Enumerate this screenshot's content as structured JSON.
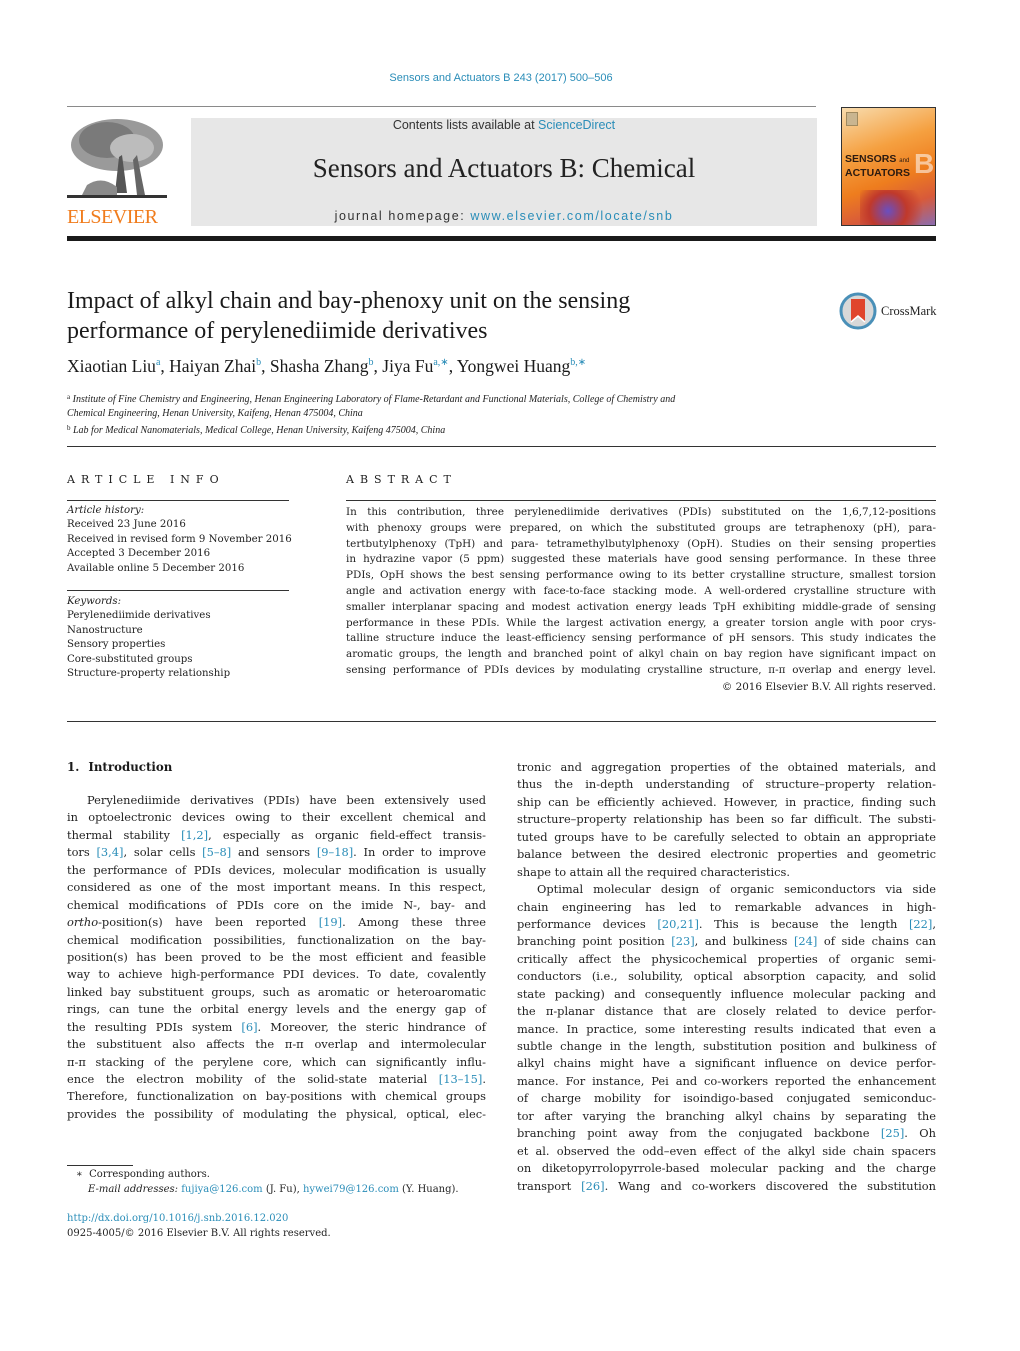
{
  "header": {
    "journal_ref": "Sensors and Actuators B 243 (2017) 500–506",
    "contents_prefix": "Contents lists available at ",
    "contents_link": "ScienceDirect",
    "journal_name": "Sensors and Actuators B: Chemical",
    "homepage_prefix": "journal homepage: ",
    "homepage_link": "www.elsevier.com/locate/snb",
    "publisher_logo_text": "ELSEVIER",
    "cover_title_line1": "SENSORS",
    "cover_title_and": "and",
    "cover_title_line2": "ACTUATORS",
    "cover_letter": "B"
  },
  "article": {
    "title_line1": "Impact of alkyl chain and bay-phenoxy unit on the sensing",
    "title_line2": "performance of perylenediimide derivatives",
    "crossmark_label": "CrossMark",
    "authors": [
      {
        "name": "Xiaotian Liu",
        "sup": "a",
        "sep": ", "
      },
      {
        "name": "Haiyan Zhai",
        "sup": "b",
        "sep": ", "
      },
      {
        "name": "Shasha Zhang",
        "sup": "b",
        "sep": ", "
      },
      {
        "name": "Jiya Fu",
        "sup": "a,∗",
        "sep": ", "
      },
      {
        "name": "Yongwei Huang",
        "sup": "b,∗",
        "sep": ""
      }
    ],
    "affiliations": [
      {
        "sup": "a",
        "line1": "Institute of Fine Chemistry and Engineering, Henan Engineering Laboratory of Flame-Retardant and Functional Materials, College of Chemistry and",
        "line2": "Chemical Engineering, Henan University, Kaifeng, Henan 475004, China"
      },
      {
        "sup": "b",
        "line1": "Lab for Medical Nanomaterials, Medical College, Henan University, Kaifeng 475004, China"
      }
    ]
  },
  "article_info": {
    "heading": "ARTICLE INFO",
    "history_label": "Article history:",
    "history": [
      "Received 23 June 2016",
      "Received in revised form 9 November 2016",
      "Accepted 3 December 2016",
      "Available online 5 December 2016"
    ],
    "keywords_label": "Keywords:",
    "keywords": [
      "Perylenediimide derivatives",
      "Nanostructure",
      "Sensory properties",
      "Core-substituted groups",
      "Structure-property relationship"
    ]
  },
  "abstract": {
    "heading": "ABSTRACT",
    "lines": [
      "In this contribution, three perylenediimide derivatives (PDIs) substituted on the 1,6,7,12-positions",
      "with phenoxy groups were prepared, on which the substituted groups are tetraphenoxy (pH), para-",
      "tertbutylphenoxy (TpH) and para- tetramethylbutylphenoxy (OpH). Studies on their sensing properties",
      "in hydrazine vapor (5 ppm) suggested these materials have good sensing performance. In these three",
      "PDIs, OpH shows the best sensing performance owing to its better crystalline structure, smallest torsion",
      "angle and activation energy with face-to-face stacking mode. A well-ordered crystalline structure with",
      "smaller interplanar spacing and modest activation energy leads TpH exhibiting middle-grade of sensing",
      "performance in these PDIs. While the largest activation energy, a greater torsion angle with poor crys-",
      "talline structure induce the least-efficiency sensing performance of pH sensors. This study indicates the",
      "aromatic groups, the length and branched point of alkyl chain on bay region have significant impact on",
      "sensing performance of PDIs devices by modulating crystalline structure, π-π overlap and energy level."
    ],
    "copyright": "© 2016 Elsevier B.V. All rights reserved."
  },
  "body": {
    "section_number": "1.",
    "section_title": "Introduction",
    "left_lines": [
      "Perylenediimide derivatives (PDIs) have been extensively used",
      "in optoelectronic devices owing to their excellent chemical and",
      "thermal stability [1,2], especially as organic field-effect transis-",
      "tors [3,4], solar cells [5–8] and sensors [9–18]. In order to improve",
      "the performance of PDIs devices, molecular modification is usually",
      "considered as one of the most important means. In this respect,",
      "chemical modifications of PDIs core on the imide N-, bay- and",
      "ortho-position(s) have been reported [19]. Among these three",
      "chemical modification possibilities, functionalization on the bay-",
      "position(s) has been proved to be the most efficient and feasible",
      "way to achieve high-performance PDI devices. To date, covalently",
      "linked bay substituent groups, such as aromatic or heteroaromatic",
      "rings, can tune the orbital energy levels and the energy gap of",
      "the resulting PDIs system [6]. Moreover, the steric hindrance of",
      "the substituent also affects the π-π overlap and intermolecular",
      "π-π stacking of the perylene core, which can significantly influ-",
      "ence the electron mobility of the solid-state material [13–15].",
      "Therefore, functionalization on bay-positions with chemical groups",
      "provides the possibility of modulating the physical, optical, elec-"
    ],
    "right_lines": [
      "tronic and aggregation properties of the obtained materials, and",
      "thus the in-depth understanding of structure–property relation-",
      "ship can be efficiently achieved. However, in practice, finding such",
      "structure–property relationship has been so far difficult. The substi-",
      "tuted groups have to be carefully selected to obtain an appropriate",
      "balance between the desired electronic properties and geometric",
      "shape to attain all the required characteristics.",
      "Optimal molecular design of organic semiconductors via side",
      "chain engineering has led to remarkable advances in high-",
      "performance devices [20,21]. This is because the length [22],",
      "branching point position [23], and bulkiness [24] of side chains can",
      "critically affect the physicochemical properties of organic semi-",
      "conductors (i.e., solubility, optical absorption capacity, and solid",
      "state packing) and consequently influence molecular packing and",
      "the π-planar distance that are closely related to device perfor-",
      "mance. In practice, some interesting results indicated that even a",
      "subtle change in the length, substitution position and bulkiness of",
      "alkyl chains might have a significant influence on device perfor-",
      "mance. For instance, Pei and co-workers reported the enhancement",
      "of charge mobility for isoindigo-based conjugated semiconduc-",
      "tor after varying the branching alkyl chains by separating the",
      "branching point away from the conjugated backbone [25]. Oh",
      "et al. observed the odd–even effect of the alkyl side chain spacers",
      "on diketopyrrolopyrrole-based molecular packing and the charge",
      "transport [26]. Wang and co-workers discovered the substitution"
    ]
  },
  "footnotes": {
    "star": "∗",
    "corresponding": "Corresponding authors.",
    "email_label": "E-mail addresses:",
    "email1": "fujiya@126.com",
    "email1_owner": " (J. Fu), ",
    "email2": "hywei79@126.com",
    "email2_owner": " (Y. Huang)."
  },
  "doi": {
    "link": "http://dx.doi.org/10.1016/j.snb.2016.12.020",
    "issn_line": "0925-4005/© 2016 Elsevier B.V. All rights reserved."
  },
  "colors": {
    "link": "#2a8db8",
    "elsevier_orange": "#f07c1c",
    "banner_gray": "#e7e7e7"
  }
}
